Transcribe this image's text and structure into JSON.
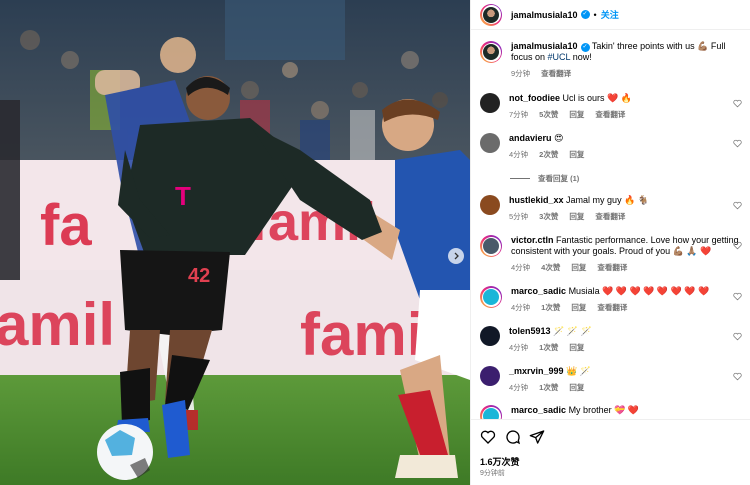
{
  "post": {
    "username": "jamalmusiala10",
    "verified": true,
    "follow_label": "关注",
    "caption_text": "Takin' three points with us 💪🏽 Full focus on",
    "caption_tag": "#UCL",
    "caption_tail": " now!",
    "caption_time": "9分钟",
    "caption_translate": "查看翻译",
    "likes": "1.6万次赞",
    "posted_ago": "9分钟前"
  },
  "comments": [
    {
      "user": "not_foodiee",
      "text": "Ucl is ours ❤️ 🔥",
      "time": "7分钟",
      "likes": "5次赞",
      "reply": "回复",
      "translate": "查看翻译",
      "avatar_color": "#222222"
    },
    {
      "user": "andavieru",
      "text": "😍",
      "time": "4分钟",
      "likes": "2次赞",
      "reply": "回复",
      "translate": "",
      "avatar_color": "#6b6b6b",
      "view_replies": "查看回复 (1)"
    },
    {
      "user": "hustlekid_xx",
      "text": "Jamal my guy 🔥 🐐",
      "time": "5分钟",
      "likes": "3次赞",
      "reply": "回复",
      "translate": "查看翻译",
      "avatar_color": "#8a4a1f"
    },
    {
      "user": "victor.ctln",
      "text": "Fantastic performance. Love how your getting consistent with your goals. Proud of you 💪🏽 🙏🏽 ❤️",
      "time": "4分钟",
      "likes": "4次赞",
      "reply": "回复",
      "translate": "查看翻译",
      "avatar_color": "#4a5a6a",
      "ring": true
    },
    {
      "user": "marco_sadic",
      "text": "Musiala ❤️ ❤️ ❤️ ❤️ ❤️ ❤️ ❤️ ❤️",
      "time": "4分钟",
      "likes": "1次赞",
      "reply": "回复",
      "translate": "查看翻译",
      "avatar_color": "#1ab6d8",
      "ring": true
    },
    {
      "user": "tolen5913",
      "text": "🪄 🪄 🪄",
      "time": "4分钟",
      "likes": "1次赞",
      "reply": "回复",
      "translate": "",
      "avatar_color": "#111827"
    },
    {
      "user": "_mxrvin_999",
      "text": "👑 🪄",
      "time": "4分钟",
      "likes": "1次赞",
      "reply": "回复",
      "translate": "",
      "avatar_color": "#3b1f6e"
    },
    {
      "user": "marco_sadic",
      "text": "My brother 💝 ❤️",
      "time": "",
      "likes": "",
      "reply": "",
      "translate": "",
      "avatar_color": "#1ab6d8",
      "ring": true
    }
  ],
  "icons": {
    "like": "heart-icon",
    "comment": "comment-icon",
    "share": "send-icon",
    "next": "chevron-right-icon"
  },
  "colors": {
    "verified": "#0095f6",
    "follow": "#0095f6",
    "heart_red": "#ed4956",
    "jersey_dark": "#1d2a26",
    "opponent_blue": "#2355b0",
    "board_red": "#d81e3a"
  }
}
